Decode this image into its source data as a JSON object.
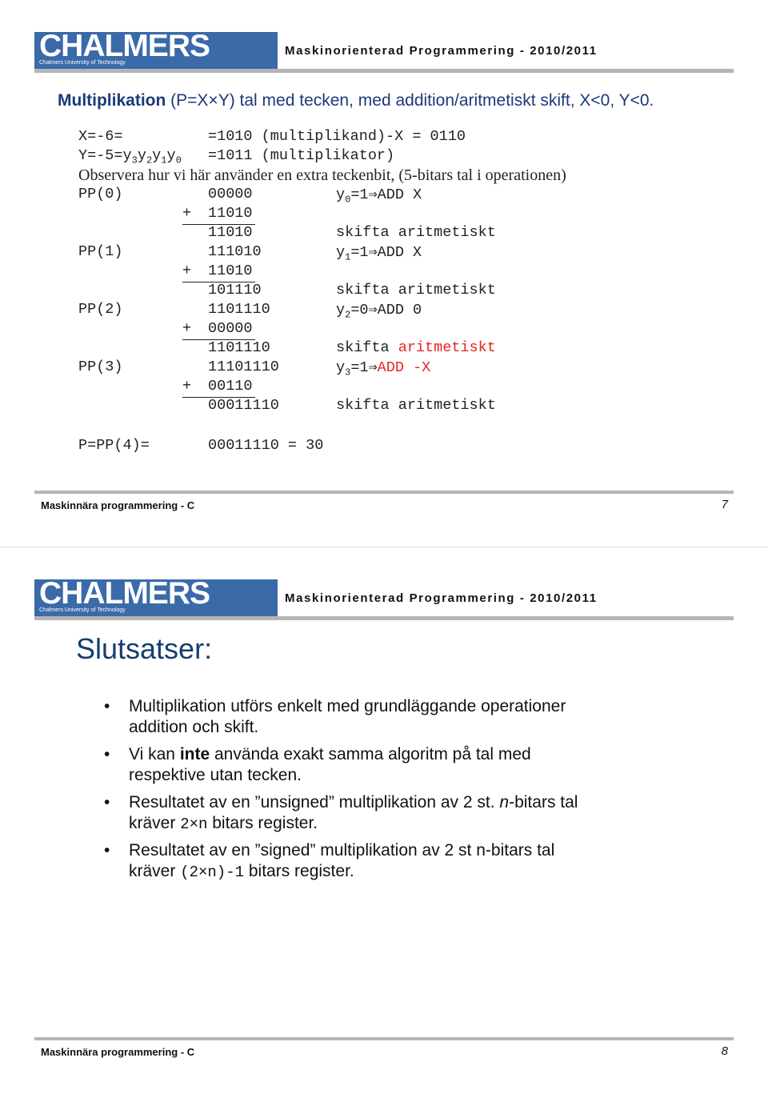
{
  "slides": [
    {
      "logo": "CHALMERS",
      "logo_sub": "Chalmers University of Technology",
      "header": "Maskinorienterad Programmering - 2010/2011",
      "footer": "Maskinnära programmering - C",
      "page": "7",
      "title_bold": "Multiplikation",
      "title_rest": " (P=X×Y) tal med tecken, med addition/aritmetiskt skift, X<0, Y<0."
    },
    {
      "logo": "CHALMERS",
      "logo_sub": "Chalmers University of Technology",
      "header": "Maskinorienterad Programmering - 2010/2011",
      "footer": "Maskinnära programmering - C",
      "page": "8",
      "title": "Slutsatser:"
    }
  ],
  "calc": {
    "x_label": "X=-6=",
    "x_value": "=1010 (multiplikand)-X = 0110",
    "y_label_parts": [
      {
        "t": "Y=-5=y"
      },
      {
        "t": "3",
        "sub": true
      },
      {
        "t": "y"
      },
      {
        "t": "2",
        "sub": true
      },
      {
        "t": "y"
      },
      {
        "t": "1",
        "sub": true
      },
      {
        "t": "y"
      },
      {
        "t": "0",
        "sub": true
      }
    ],
    "y_value": "=1011 (multiplikator)",
    "note": "Observera hur vi här använder en extra teckenbit, (5-bitars tal i operationen)",
    "rows": [
      {
        "label": "PP(0)",
        "value": "00000",
        "comment": [
          {
            "t": "y"
          },
          {
            "t": "0",
            "sub": true
          },
          {
            "t": "=1⇒ADD X"
          }
        ]
      },
      {
        "plus": "+",
        "value": "11010",
        "underline": true,
        "comment": []
      },
      {
        "value": "11010",
        "comment": [
          {
            "t": "skifta aritmetiskt"
          }
        ]
      },
      {
        "label": "PP(1)",
        "value": "111010",
        "comment": [
          {
            "t": "y"
          },
          {
            "t": "1",
            "sub": true
          },
          {
            "t": "=1⇒ADD X"
          }
        ]
      },
      {
        "plus": "+",
        "value": "11010",
        "underline": true,
        "comment": []
      },
      {
        "value": "101110",
        "comment": [
          {
            "t": "skifta aritmetiskt"
          }
        ]
      },
      {
        "label": "PP(2)",
        "value": "1101110",
        "comment": [
          {
            "t": "y"
          },
          {
            "t": "2",
            "sub": true
          },
          {
            "t": "=0⇒ADD 0"
          }
        ]
      },
      {
        "plus": "+",
        "value": "00000",
        "underline": true,
        "comment": []
      },
      {
        "value": "1101110",
        "comment": [
          {
            "t": "skifta "
          },
          {
            "t": "aritmetiskt",
            "red": true
          }
        ]
      },
      {
        "label": "PP(3)",
        "value": "11101110",
        "comment": [
          {
            "t": "y"
          },
          {
            "t": "3",
            "sub": true
          },
          {
            "t": "=1⇒"
          },
          {
            "t": "ADD -X",
            "red": true
          }
        ]
      },
      {
        "plus": "+",
        "value": "00110",
        "underline": true,
        "comment": []
      },
      {
        "value": "00011110",
        "comment": [
          {
            "t": "skifta aritmetiskt"
          }
        ]
      }
    ],
    "result_label": "P=PP(4)=",
    "result_value": "00011110 = 30"
  },
  "bullets": [
    [
      {
        "t": "Multiplikation utförs enkelt med grundläggande operationer addition och skift."
      }
    ],
    [
      {
        "t": "Vi kan "
      },
      {
        "t": "inte",
        "b": true
      },
      {
        "t": " använda exakt samma algoritm på tal med respektive utan tecken."
      }
    ],
    [
      {
        "t": "Resultatet av en ”unsigned” multiplikation av 2 st. "
      },
      {
        "t": "n",
        "i": true
      },
      {
        "t": "-bitars tal  kräver "
      },
      {
        "t": "2×n",
        "m": true
      },
      {
        "t": " bitars register."
      }
    ],
    [
      {
        "t": "Resultatet av en ”signed” multiplikation av 2 st n-bitars tal kräver "
      },
      {
        "t": "(2×n)-1",
        "m": true
      },
      {
        "t": " bitars register."
      }
    ]
  ],
  "colors": {
    "title": "#1b3a78",
    "accent_red": "#e3261e",
    "logo": "#3b6aa9"
  }
}
